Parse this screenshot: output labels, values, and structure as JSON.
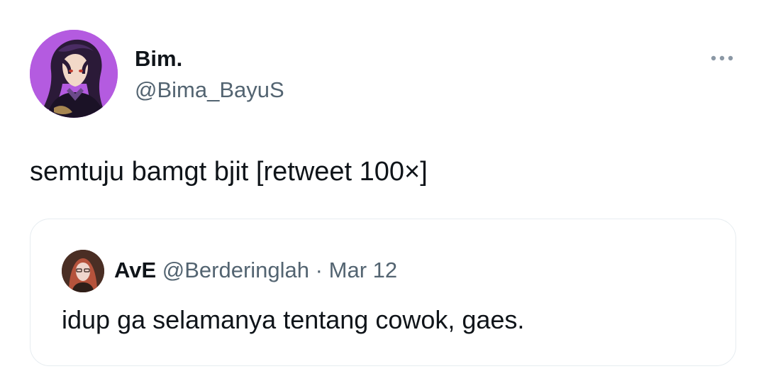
{
  "author": {
    "display_name": "Bim.",
    "handle": "@Bima_BayuS",
    "avatar_icon": "user-avatar-icon"
  },
  "tweet": {
    "text": "semtuju bamgt bjit [retweet 100×]"
  },
  "more_options": {
    "icon": "more-horizontal-icon"
  },
  "quoted_tweet": {
    "display_name": "AvE",
    "handle": "@Berderinglah",
    "separator": "·",
    "date": "Mar 12",
    "text": "idup ga selamanya tentang cowok, gaes.",
    "avatar_icon": "user-avatar-icon"
  },
  "colors": {
    "text_primary": "#0f1419",
    "text_secondary": "#536471",
    "border": "#e6ecf0",
    "avatar_bg": "#b45be0"
  }
}
